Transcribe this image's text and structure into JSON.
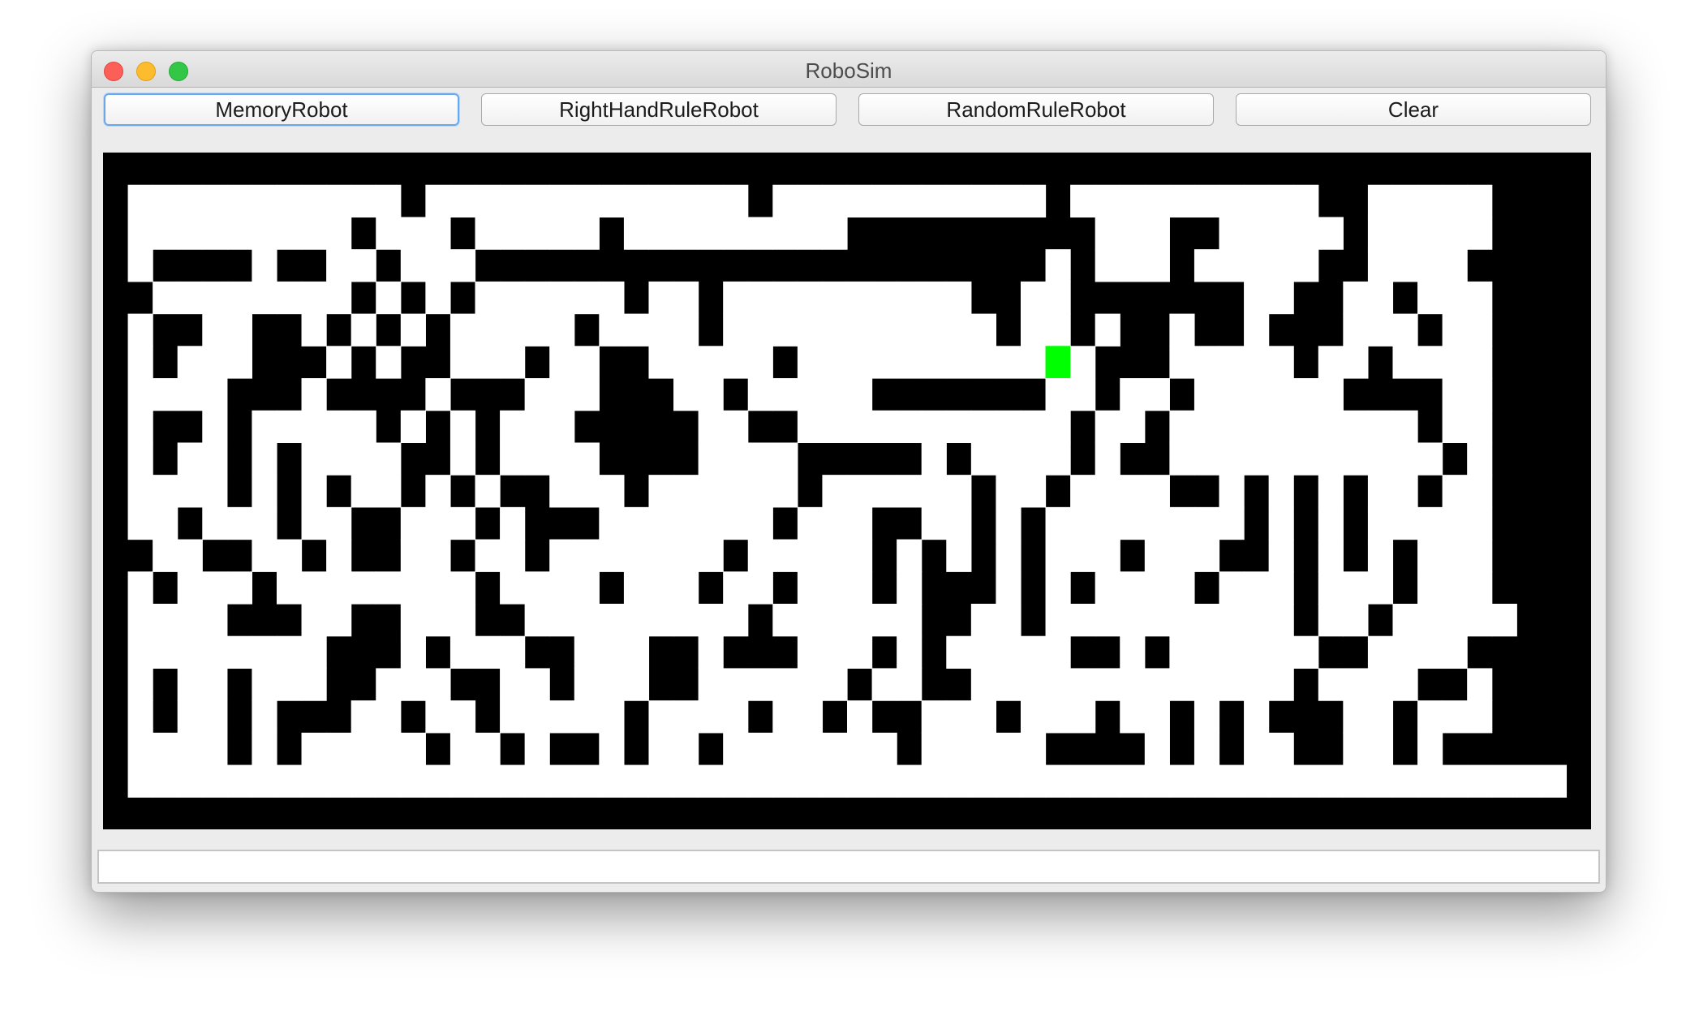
{
  "window": {
    "title": "RoboSim"
  },
  "toolbar": {
    "buttons": [
      {
        "label": "MemoryRobot",
        "focused": true
      },
      {
        "label": "RightHandRuleRobot",
        "focused": false
      },
      {
        "label": "RandomRuleRobot",
        "focused": false
      },
      {
        "label": "Clear",
        "focused": false
      }
    ]
  },
  "maze": {
    "wall_color": "#000000",
    "path_color": "#ffffff",
    "robot_color": "#00ff00",
    "robot_cell": {
      "row": 6,
      "col": 38
    },
    "grid": [
      "#########################################################",
      "#...........#.............#...........#..........##.....#",
      "#.........#...#.....#.........##########...##.....#.....#",
      "#.####.##..#...#######################.#...#.....##....##",
      "##........#.#.#......#..#..........##..#######..##..#...#",
      "#.##..##.#.#.#.....#....#...........#..#.##.##.###...#..#",
      "#.#...###.#.##...#..##.....#..........#.###.....#..#....#",
      "#....###.####.###...###..#.....#######..#..#......####..#",
      "#.##.#.....#.#.#...#####..##...........#..#..........#..#",
      "#.#..#.#....##.#....####....#####.#....#.##...........#.#",
      "#....#.#.#..#.#.##...#......#......#..#....##.#.#.#..#..#",
      "#..#...#..##...#.###.......#...##..#.#........#.#.#.....#",
      "##..##..#.##..#..#.......#.....#.#.#.#...#...##.#.#.#...#",
      "#.#...#........#....#...#..#...#.###.#.#....#...#...#...#",
      "#....###..##...##.........#......##..#..........#..#.....#",
      "#........###.#...##...##.###...#.#.....##.#......##....#",
      "#.#..#...##...##..#...##......#..##.............#....##.#",
      "#.#..#.###..#..#.....#....#..#.##...#...#..#.#.###..#...#",
      "#....#.#.....#..#.##.#..#.......#.....####.#.#..##..#.###",
      "#..........................................................#",
      "#########################################################"
    ]
  },
  "status": {
    "text": ""
  }
}
